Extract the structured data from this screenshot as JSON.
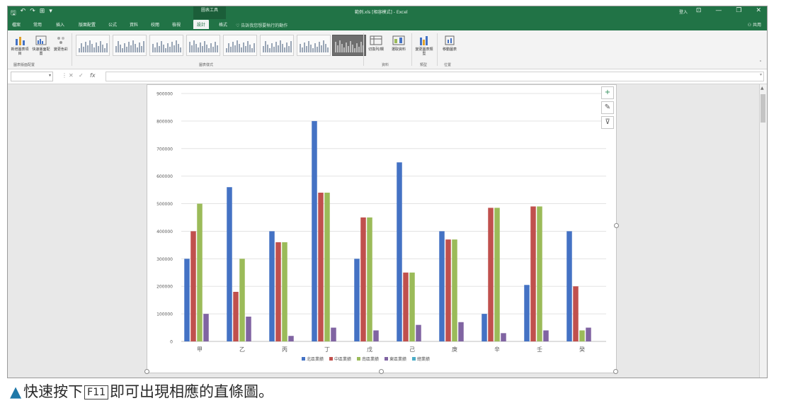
{
  "window": {
    "quick_access": [
      "🖫",
      "↶",
      "↷",
      "⊞",
      "▾"
    ],
    "context_group": "圖表工具",
    "title": "範例.xls [相容模式] - Excel",
    "login": "登入",
    "window_buttons": [
      "⊡",
      "—",
      "❐",
      "✕"
    ]
  },
  "tabs": [
    "檔案",
    "常用",
    "插入",
    "版面配置",
    "公式",
    "資料",
    "校閱",
    "檢視",
    "設計",
    "格式"
  ],
  "active_tab": "設計",
  "tell_me": "告訴我您想要執行的動作",
  "share": "共用",
  "ribbon": {
    "add_element": "新增圖表項目",
    "quick_layout": "快速版面配置",
    "change_colors": "變更色彩",
    "group_layouts": "圖表版面配置",
    "group_styles": "圖表樣式",
    "switch_row_col": "切換列/欄",
    "select_data": "選取資料",
    "group_data": "資料",
    "change_type": "變更圖表類型",
    "group_type": "類型",
    "move_chart": "移動圖表",
    "group_location": "位置"
  },
  "formula": {
    "name_box": "",
    "cancel": "✕",
    "enter": "✓",
    "fx": "fx",
    "value": ""
  },
  "chart_tools": [
    "+",
    "✎",
    "⊽"
  ],
  "chart_data": {
    "type": "bar",
    "categories": [
      "甲",
      "乙",
      "丙",
      "丁",
      "戊",
      "己",
      "庚",
      "辛",
      "壬",
      "癸"
    ],
    "series": [
      {
        "name": "北區業績",
        "color": "#4472c4",
        "values": [
          300000,
          560000,
          400000,
          800000,
          300000,
          650000,
          400000,
          100000,
          205000,
          400000
        ]
      },
      {
        "name": "中區業績",
        "color": "#c0504d",
        "values": [
          400000,
          180000,
          360000,
          540000,
          450000,
          250000,
          370000,
          485000,
          490000,
          200000
        ]
      },
      {
        "name": "南區業績",
        "color": "#9bbb59",
        "values": [
          500000,
          300000,
          360000,
          540000,
          450000,
          250000,
          370000,
          485000,
          490000,
          40000
        ]
      },
      {
        "name": "東區業績",
        "color": "#8064a2",
        "values": [
          100000,
          90000,
          20000,
          50000,
          40000,
          60000,
          70000,
          30000,
          40000,
          50000
        ]
      },
      {
        "name": "總業績",
        "color": "#4bacc6",
        "values": [
          0,
          0,
          0,
          0,
          0,
          0,
          0,
          0,
          0,
          0
        ]
      }
    ],
    "yticks": [
      "0",
      "100000",
      "200000",
      "300000",
      "400000",
      "500000",
      "600000",
      "700000",
      "800000",
      "900000"
    ],
    "ylim": [
      0,
      900000
    ],
    "grid": true,
    "legend": "bottom"
  },
  "caption": {
    "marker": "▲",
    "before": "快速按下",
    "key": "F11",
    "after": "即可出現相應的直條圖。"
  }
}
